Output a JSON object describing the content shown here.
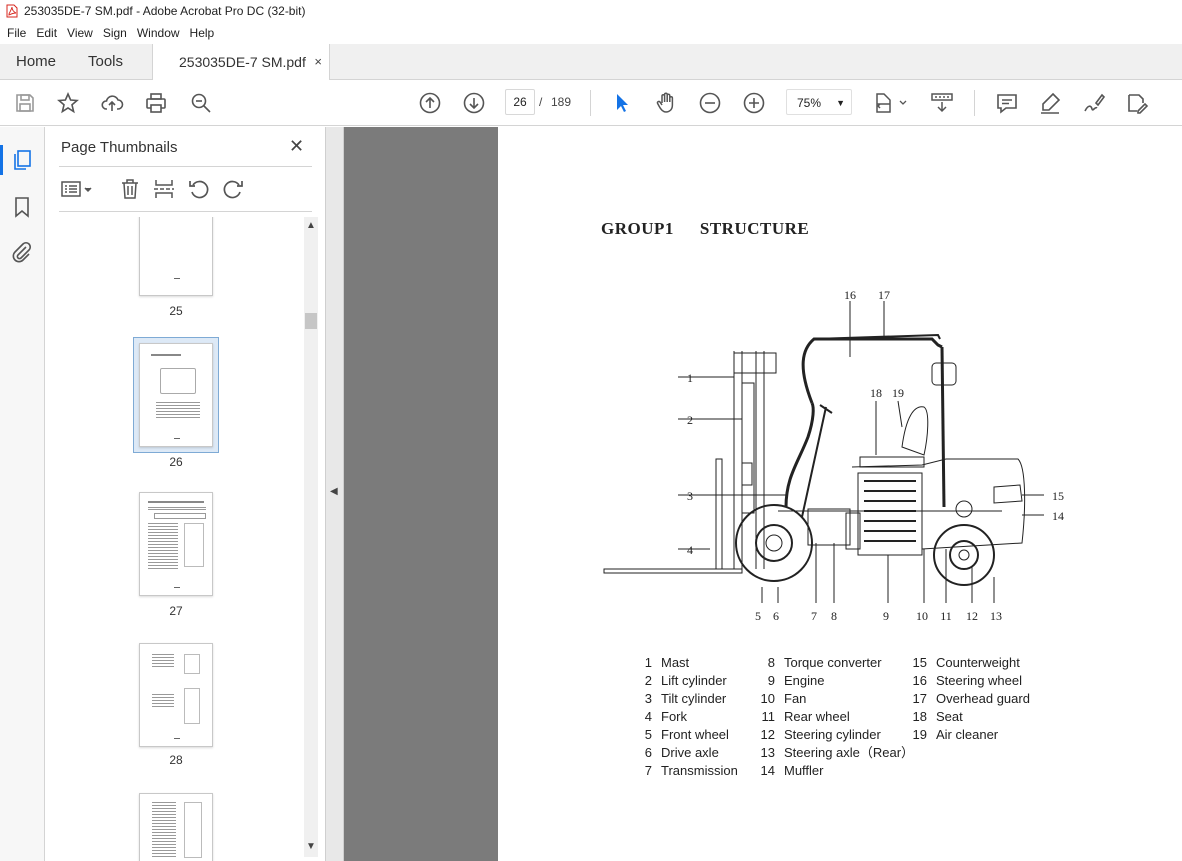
{
  "window": {
    "title": "253035DE-7 SM.pdf - Adobe Acrobat Pro DC (32-bit)"
  },
  "menu": [
    "File",
    "Edit",
    "View",
    "Sign",
    "Window",
    "Help"
  ],
  "tabs": {
    "home": "Home",
    "tools": "Tools",
    "document": "253035DE-7 SM.pdf",
    "close": "×"
  },
  "toolbar": {
    "current_page": "26",
    "separator": "/",
    "total_pages": "189",
    "zoom": "75%"
  },
  "sidebar": {
    "title": "Page Thumbnails",
    "close": "✕",
    "thumbnails": [
      {
        "page": "25"
      },
      {
        "page": "26",
        "selected": true
      },
      {
        "page": "27"
      },
      {
        "page": "28"
      }
    ]
  },
  "document_page": {
    "heading_group": "GROUP1",
    "heading_title": "STRUCTURE",
    "callouts": [
      "1",
      "2",
      "3",
      "4",
      "5",
      "6",
      "7",
      "8",
      "9",
      "10",
      "11",
      "12",
      "13",
      "14",
      "15",
      "16",
      "17",
      "18",
      "19"
    ],
    "legend_col1": [
      {
        "n": "1",
        "label": "Mast"
      },
      {
        "n": "2",
        "label": "Lift cylinder"
      },
      {
        "n": "3",
        "label": "Tilt cylinder"
      },
      {
        "n": "4",
        "label": "Fork"
      },
      {
        "n": "5",
        "label": "Front wheel"
      },
      {
        "n": "6",
        "label": "Drive axle"
      },
      {
        "n": "7",
        "label": "Transmission"
      }
    ],
    "legend_col2": [
      {
        "n": "8",
        "label": "Torque converter"
      },
      {
        "n": "9",
        "label": "Engine"
      },
      {
        "n": "10",
        "label": "Fan"
      },
      {
        "n": "11",
        "label": "Rear wheel"
      },
      {
        "n": "12",
        "label": "Steering cylinder"
      },
      {
        "n": "13",
        "label": "Steering axle（Rear）"
      },
      {
        "n": "14",
        "label": "Muffler"
      }
    ],
    "legend_col3": [
      {
        "n": "15",
        "label": "Counterweight"
      },
      {
        "n": "16",
        "label": "Steering wheel"
      },
      {
        "n": "17",
        "label": "Overhead guard"
      },
      {
        "n": "18",
        "label": "Seat"
      },
      {
        "n": "19",
        "label": "Air cleaner"
      }
    ]
  },
  "colors": {
    "accent": "#1473e6",
    "pdf_red": "#d7261e",
    "canvas_gray": "#7b7b7b"
  }
}
